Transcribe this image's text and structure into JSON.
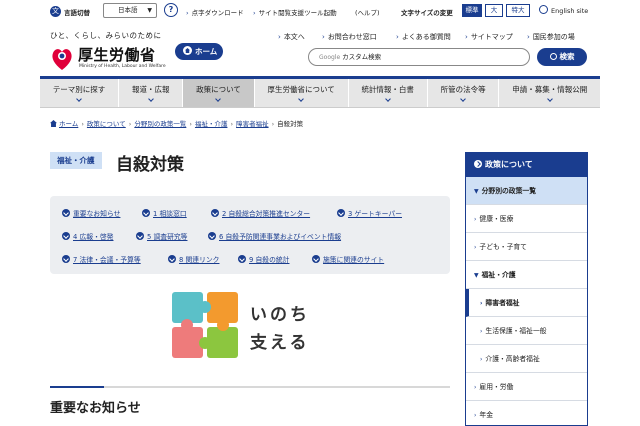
{
  "util": {
    "lang_label": "言語切替",
    "lang_value": "日本語",
    "links": [
      "点字ダウンロード",
      "サイト閲覧支援ツール起動",
      "(ヘルプ)"
    ],
    "size_label": "文字サイズの変更",
    "sizes": [
      "標準",
      "大",
      "特大"
    ],
    "english": "English site"
  },
  "header": {
    "tagline": "ひと、くらし、みらいのために",
    "logo_title": "厚生労働省",
    "logo_sub": "Ministry of Health, Labour and Welfare",
    "home_button": "ホーム",
    "links": [
      "本文へ",
      "お問合わせ窓口",
      "よくある御質問",
      "サイトマップ",
      "国民参加の場"
    ],
    "search_prefix": "Google",
    "search_placeholder": "カスタム検索",
    "search_button": "検索"
  },
  "gnav": [
    "テーマ別に探す",
    "報道・広報",
    "政策について",
    "厚生労働省について",
    "統計情報・白書",
    "所管の法令等",
    "申請・募集・情報公開"
  ],
  "breadcrumb": [
    "ホーム",
    "政策について",
    "分野別の政策一覧",
    "福祉・介護",
    "障害者福祉",
    "自殺対策"
  ],
  "page": {
    "category": "福祉・介護",
    "title": "自殺対策"
  },
  "anchors": [
    "重要なお知らせ",
    "1 相談窓口",
    "2 自殺総合対策推進センター",
    "3 ゲートキーパー",
    "4 広報・啓発",
    "5 調査研究等",
    "6 自殺予防関連事業およびイベント情報",
    "7 法律・会議・予算等",
    "8 関連リンク",
    "9 自殺の統計",
    "施策に関連のサイト"
  ],
  "campaign": {
    "line1": "いのち",
    "line2": "支える"
  },
  "section_title": "重要なお知らせ",
  "side": {
    "head": "政策について",
    "items": [
      "分野別の政策一覧",
      "健康・医療",
      "子ども・子育て",
      "福祉・介護",
      "障害者福祉",
      "生活保護・福祉一般",
      "介護・高齢者福祉",
      "雇用・労働",
      "年金"
    ]
  },
  "colors": {
    "primary": "#1a3d8f",
    "nav_bg": "#e6e6e6",
    "highlight": "#cfe0f5"
  }
}
